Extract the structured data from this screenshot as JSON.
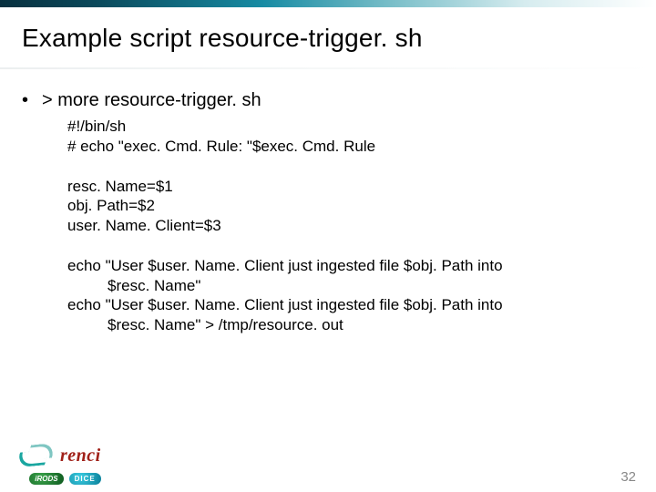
{
  "title": "Example script resource-trigger. sh",
  "bullet": {
    "marker": "•",
    "text": "> more resource-trigger. sh"
  },
  "code": {
    "block1": [
      "#!/bin/sh",
      "# echo \"exec. Cmd. Rule: \"$exec. Cmd. Rule"
    ],
    "block2": [
      "resc. Name=$1",
      "obj. Path=$2",
      "user. Name. Client=$3"
    ],
    "block3": {
      "l1": "echo \"User $user. Name. Client just ingested file $obj. Path into",
      "l1b": "$resc. Name\"",
      "l2": "echo \"User $user. Name. Client just ingested file $obj. Path into",
      "l2b": "$resc. Name\" > /tmp/resource. out"
    }
  },
  "footer": {
    "brand": "renci",
    "badge_irods": "iRODS",
    "badge_dice": "DICE",
    "page_number": "32"
  }
}
